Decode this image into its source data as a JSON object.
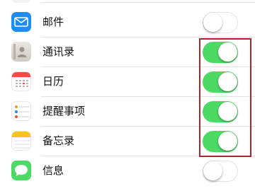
{
  "settings": {
    "rows": [
      {
        "label": "邮件",
        "icon": "mail-icon",
        "enabled": false
      },
      {
        "label": "通讯录",
        "icon": "contacts-icon",
        "enabled": true
      },
      {
        "label": "日历",
        "icon": "calendar-icon",
        "enabled": true
      },
      {
        "label": "提醒事项",
        "icon": "reminders-icon",
        "enabled": true
      },
      {
        "label": "备忘录",
        "icon": "notes-icon",
        "enabled": true
      },
      {
        "label": "信息",
        "icon": "messages-icon",
        "enabled": false
      }
    ]
  },
  "colors": {
    "toggle_on": "#4cd964",
    "highlight": "#a8262c",
    "mail_icon": "#1e8cf0",
    "messages_icon": "#4cd964",
    "notes_icon": "#f9c413"
  }
}
